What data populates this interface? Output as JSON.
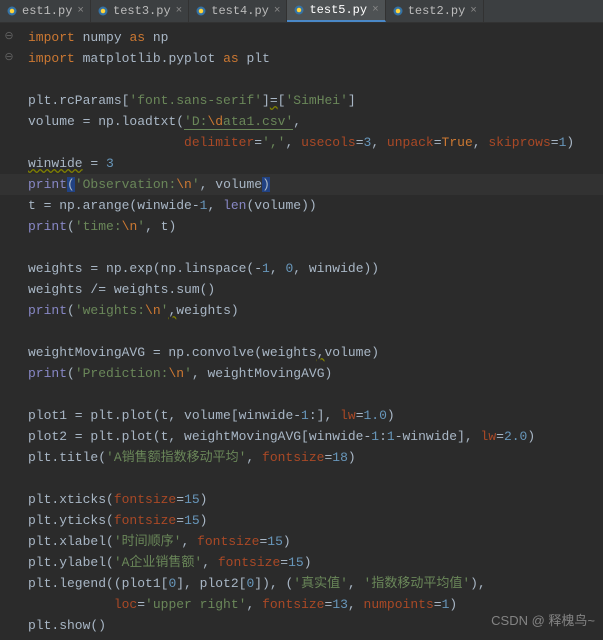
{
  "tabs": {
    "t0": "est1.py",
    "t1": "test3.py",
    "t2": "test4.py",
    "t3": "test5.py",
    "t4": "test2.py"
  },
  "code": {
    "l1a": "import",
    "l1b": "numpy",
    "l1c": "as",
    "l1d": "np",
    "l2a": "import",
    "l2b": "matplotlib.pyplot",
    "l2c": "as",
    "l2d": "plt",
    "l4a": "plt.rcParams[",
    "l4b": "'font.sans-serif'",
    "l4c": "]",
    "l4d": "=",
    "l4e": "[",
    "l4f": "'SimHei'",
    "l4g": "]",
    "l5a": "volume = np.loadtxt(",
    "l5b": "'D:",
    "l5c": "\\d",
    "l5d": "ata1.csv'",
    "l5e": ",",
    "l6a": "                    ",
    "l6b": "delimiter",
    "l6c": "=",
    "l6d": "','",
    "l6e": ", ",
    "l6f": "usecols",
    "l6g": "=",
    "l6h": "3",
    "l6i": ", ",
    "l6j": "unpack",
    "l6k": "=",
    "l6l": "True",
    "l6m": ", ",
    "l6n": "skiprows",
    "l6o": "=",
    "l6p": "1",
    "l6q": ")",
    "l7a": "winwide",
    "l7b": " = ",
    "l7c": "3",
    "l8a": "print",
    "l8b": "(",
    "l8c": "'Observation:",
    "l8d": "\\n",
    "l8e": "'",
    "l8f": ", volume",
    ")": ")",
    "l9a": "t = np.arange(winwide-",
    "l9b": "1",
    "l9c": ", ",
    "l9d": "len",
    "l9e": "(volume))",
    "l10a": "print",
    "l10b": "(",
    "l10c": "'time:",
    "l10d": "\\n",
    "l10e": "'",
    "l10f": ", t)",
    "l12a": "weights = np.exp(np.linspace(-",
    "l12b": "1",
    "l12c": ", ",
    "l12d": "0",
    "l12e": ", winwide))",
    "l13a": "weights /= weights.sum()",
    "l14a": "print",
    "l14b": "(",
    "l14c": "'weights:",
    "l14d": "\\n",
    "l14e": "'",
    "l14f": ",",
    "l14g": "weights)",
    "l16a": "weightMovingAVG = np.convolve(weights",
    "l16b": ",",
    "l16c": "volume)",
    "l17a": "print",
    "l17b": "(",
    "l17c": "'Prediction:",
    "l17d": "\\n",
    "l17e": "'",
    "l17f": ", weightMovingAVG)",
    "l19a": "plot1 = plt.plot(t, volume[winwide-",
    "l19b": "1",
    "l19c": ":], ",
    "l19d": "lw",
    "l19e": "=",
    "l19f": "1.0",
    "l19g": ")",
    "l20a": "plot2 = plt.plot(t, weightMovingAVG[winwide-",
    "l20b": "1",
    "l20c": ":",
    "l20d": "1",
    "l20e": "-winwide], ",
    "l20f": "lw",
    "l20g": "=",
    "l20h": "2.0",
    "l20i": ")",
    "l21a": "plt.title(",
    "l21b": "'A销售额指数移动平均'",
    "l21c": ", ",
    "l21d": "fontsize",
    "l21e": "=",
    "l21f": "18",
    "l21g": ")",
    "l23a": "plt.xticks(",
    "l23b": "fontsize",
    "l23c": "=",
    "l23d": "15",
    "l23e": ")",
    "l24a": "plt.yticks(",
    "l24b": "fontsize",
    "l24c": "=",
    "l24d": "15",
    "l24e": ")",
    "l25a": "plt.xlabel(",
    "l25b": "'时间顺序'",
    "l25c": ", ",
    "l25d": "fontsize",
    "l25e": "=",
    "l25f": "15",
    "l25g": ")",
    "l26a": "plt.ylabel(",
    "l26b": "'A企业销售额'",
    "l26c": ", ",
    "l26d": "fontsize",
    "l26e": "=",
    "l26f": "15",
    "l26g": ")",
    "l27a": "plt.legend((plot1[",
    "l27b": "0",
    "l27c": "], plot2[",
    "l27d": "0",
    "l27e": "]), (",
    "l27f": "'真实值'",
    "l27g": ", ",
    "l27h": "'指数移动平均值'",
    "l27i": "),",
    "l28a": "           ",
    "l28b": "loc",
    "l28c": "=",
    "l28d": "'upper right'",
    "l28e": ", ",
    "l28f": "fontsize",
    "l28g": "=",
    "l28h": "13",
    "l28i": ", ",
    "l28j": "numpoints",
    "l28k": "=",
    "l28l": "1",
    "l28m": ")",
    "l29a": "plt.show()"
  },
  "watermark": "CSDN @ 释槐鸟~"
}
